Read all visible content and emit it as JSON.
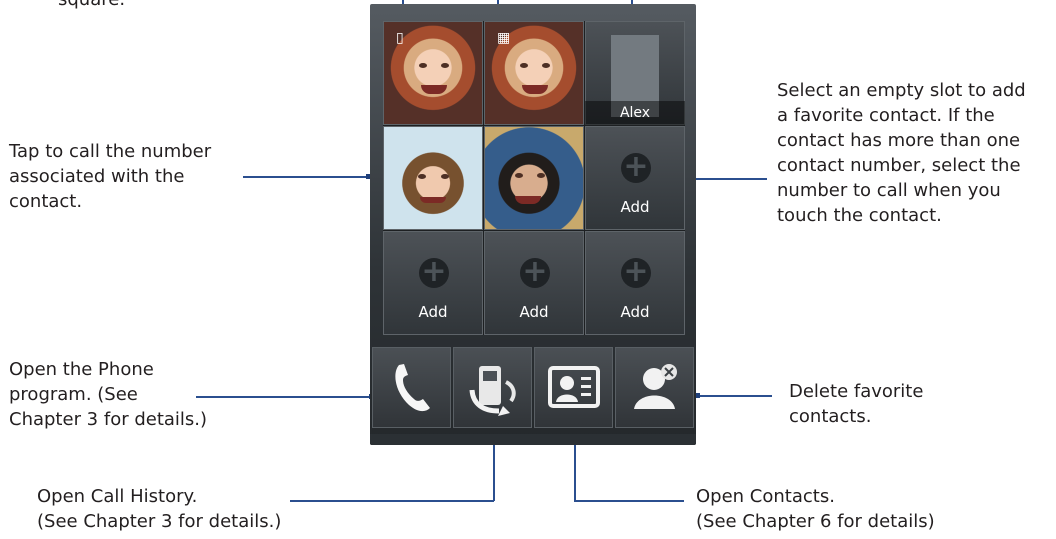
{
  "callouts": {
    "top_left": "square.",
    "tap_contact": "Tap to call the number\nassociated with the\ncontact.",
    "empty_slot": "Select an empty slot to add\na favorite contact. If the\ncontact has more than one\ncontact number, select the\nnumber to call when you\ntouch the contact.",
    "open_phone": "Open the Phone\nprogram. (See\nChapter 3 for details.)",
    "delete_favorite": "Delete favorite\ncontacts.",
    "call_history": "Open Call History.\n(See Chapter 3 for details.)",
    "contacts": "Open Contacts.\n(See Chapter 6 for details)"
  },
  "favorites": {
    "contact_alex": "Alex",
    "add_label": "Add"
  },
  "icons": {
    "mobile": "mobile-phone-icon",
    "work": "building-icon",
    "phone": "phone-icon",
    "history": "call-history-icon",
    "contacts": "contact-card-icon",
    "delete": "delete-contact-icon"
  },
  "colors": {
    "callout_line": "#2b4f8f",
    "screen_dark": "#24282b"
  }
}
